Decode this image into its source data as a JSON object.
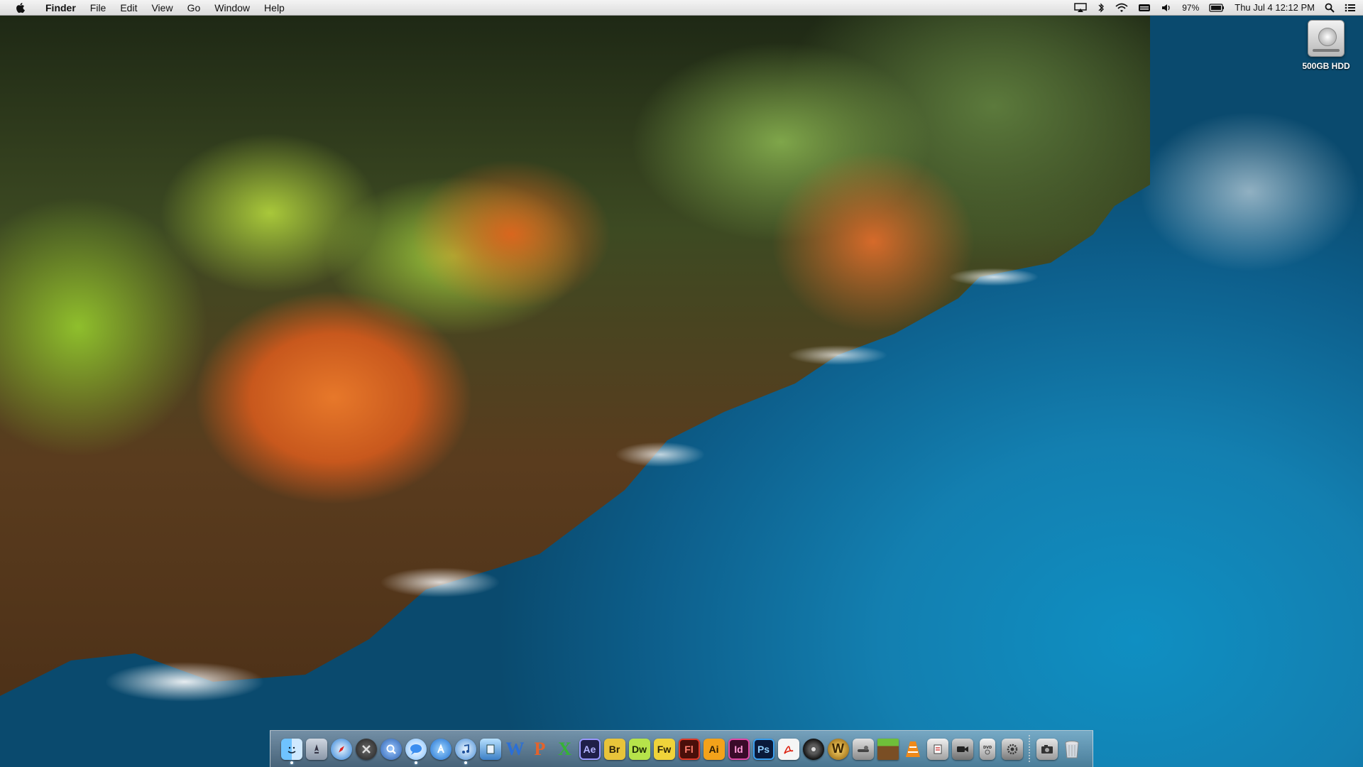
{
  "menubar": {
    "apple_icon": "apple-logo-icon",
    "app_name": "Finder",
    "menus": [
      "File",
      "Edit",
      "View",
      "Go",
      "Window",
      "Help"
    ],
    "status": {
      "battery_percent": "97%",
      "datetime": "Thu Jul 4  12:12 PM"
    }
  },
  "desktop": {
    "disk_label": "500GB HDD"
  },
  "dock": {
    "items": [
      {
        "icon": "finder-icon"
      },
      {
        "icon": "launchpad-icon"
      },
      {
        "icon": "safari-icon"
      },
      {
        "icon": "mission-control-icon"
      },
      {
        "icon": "spotlight-icon"
      },
      {
        "icon": "messages-icon"
      },
      {
        "icon": "app-store-icon"
      },
      {
        "icon": "itunes-icon"
      },
      {
        "icon": "preview-icon"
      },
      {
        "icon": "word-icon",
        "glyph": "W"
      },
      {
        "icon": "powerpoint-icon",
        "glyph": "P"
      },
      {
        "icon": "excel-icon",
        "glyph": "X"
      },
      {
        "icon": "after-effects-icon",
        "glyph": "Ae"
      },
      {
        "icon": "bridge-icon",
        "glyph": "Br"
      },
      {
        "icon": "dreamweaver-icon",
        "glyph": "Dw"
      },
      {
        "icon": "fireworks-icon",
        "glyph": "Fw"
      },
      {
        "icon": "flash-icon",
        "glyph": "Fl"
      },
      {
        "icon": "illustrator-icon",
        "glyph": "Ai"
      },
      {
        "icon": "indesign-icon",
        "glyph": "Id"
      },
      {
        "icon": "photoshop-icon",
        "glyph": "Ps"
      },
      {
        "icon": "acrobat-icon"
      },
      {
        "icon": "logic-icon"
      },
      {
        "icon": "wow-icon",
        "glyph": "W"
      },
      {
        "icon": "steam-icon"
      },
      {
        "icon": "minecraft-icon"
      },
      {
        "icon": "vlc-icon"
      },
      {
        "icon": "script-icon"
      },
      {
        "icon": "facetime-icon"
      },
      {
        "icon": "dvd-player-icon"
      },
      {
        "icon": "system-preferences-icon"
      },
      {
        "icon": "screenshot-icon"
      },
      {
        "icon": "trash-icon"
      }
    ]
  },
  "colors": {
    "menubar_bg": "#e8e8e8",
    "ocean": "#1396c8",
    "cliff_orange": "#d9661e",
    "grass_green": "#9cc63a"
  }
}
